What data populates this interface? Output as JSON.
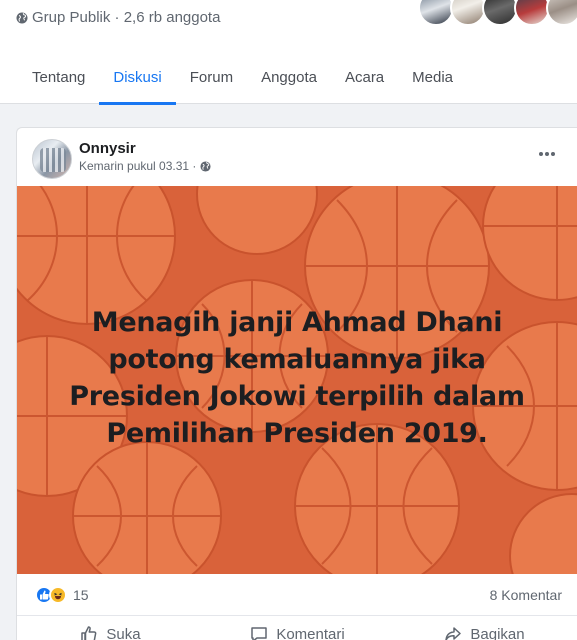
{
  "group": {
    "privacy_label": "Grup Publik · 2,6 rb anggota"
  },
  "tabs": [
    {
      "label": "Tentang"
    },
    {
      "label": "Diskusi",
      "active": true
    },
    {
      "label": "Forum"
    },
    {
      "label": "Anggota"
    },
    {
      "label": "Acara"
    },
    {
      "label": "Media"
    }
  ],
  "post": {
    "author": "Onnysir",
    "time": "Kemarin pukul 03.31 ·",
    "text": "Menagih janji Ahmad Dhani potong kemaluannya jika Presiden Jokowi terpilih dalam Pemilihan Presiden 2019.",
    "background_color": "#d9623a",
    "reaction_count": "15",
    "reaction_icons": [
      "like-icon",
      "haha-icon"
    ],
    "comment_count": "8 Komentar"
  },
  "actions": {
    "like": "Suka",
    "comment": "Komentari",
    "share": "Bagikan"
  },
  "colors": {
    "accent": "#1877f2",
    "muted_text": "#606770"
  }
}
